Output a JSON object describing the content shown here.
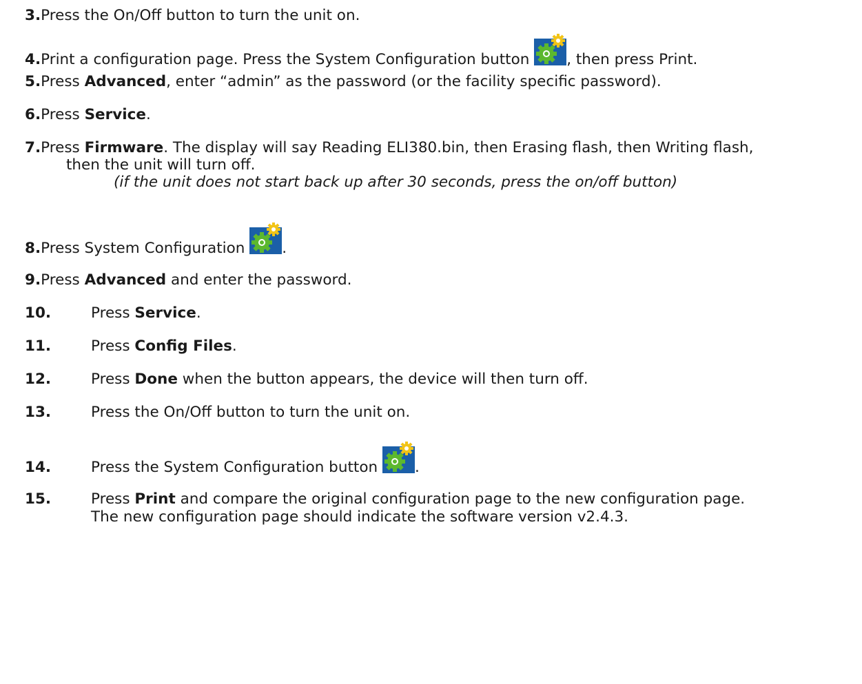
{
  "steps": [
    {
      "num": "3.",
      "text": "Press the On/Off button to turn the unit on."
    },
    {
      "num": "4.",
      "pre": "Print a configuration page. Press the System Configuration button ",
      "icon": "system-configuration-gear-icon",
      "post": ", then press Print."
    },
    {
      "num": "5.",
      "pre": "Press ",
      "bold": "Advanced",
      "post": ", enter “admin” as the password (or the facility specific password)."
    },
    {
      "num": "6.",
      "pre": "Press ",
      "bold": "Service",
      "post": "."
    },
    {
      "num": "7.",
      "pre": "Press ",
      "bold": "Firmware",
      "post": ". The display will say Reading ELI380.bin, then Erasing flash, then Writing flash,",
      "cont": "then the unit will turn off.",
      "note": "(if the unit does not start back up after 30 seconds, press the on/off button)"
    },
    {
      "num": "8.",
      "pre": "Press System Configuration ",
      "icon": "system-configuration-gear-icon",
      "post": "."
    },
    {
      "num": "9.",
      "pre": "Press ",
      "bold": "Advanced",
      "post": " and enter the password."
    },
    {
      "num": "10.",
      "pre": "Press ",
      "bold": "Service",
      "post": "."
    },
    {
      "num": "11.",
      "pre": "Press ",
      "bold": "Config Files",
      "post": "."
    },
    {
      "num": "12.",
      "pre": "Press ",
      "bold": "Done",
      "post": " when the button appears, the device will then turn off."
    },
    {
      "num": "13.",
      "text": "Press the On/Off button to turn the unit on."
    },
    {
      "num": "14.",
      "pre": "Press the System Configuration button ",
      "icon": "system-configuration-gear-icon",
      "post": "."
    },
    {
      "num": "15.",
      "pre": "Press ",
      "bold": "Print",
      "post": " and compare the original configuration page to the new configuration page.",
      "cont": "The new configuration page should indicate the software version v2.4.3."
    }
  ],
  "colors": {
    "icon_bg": "#1b5fa8",
    "gear_green": "#5cb82e",
    "gear_yellow": "#f2c417"
  }
}
